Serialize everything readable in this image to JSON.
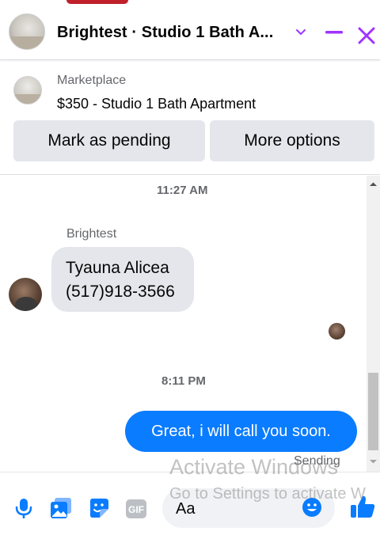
{
  "header": {
    "title": "Brightest · Studio 1 Bath A...",
    "accent_color": "#a033ff"
  },
  "listing": {
    "label": "Marketplace",
    "title": "$350 - Studio 1 Bath Apartment",
    "pending_button": "Mark as pending",
    "more_button": "More options"
  },
  "chat": {
    "timestamp_1": "11:27 AM",
    "sender_name": "Brightest",
    "incoming_line_1": "Tyauna Alicea",
    "incoming_line_2": "(517)918-3566",
    "timestamp_2": "8:11 PM",
    "outgoing_message": "Great, i will call you soon.",
    "outgoing_status": "Sending",
    "outgoing_color": "#0a7cff"
  },
  "composer": {
    "placeholder": "Aa",
    "icons": [
      "microphone-icon",
      "photo-icon",
      "sticker-icon",
      "gif-icon",
      "emoji-icon",
      "thumbs-up-icon"
    ]
  },
  "watermark": {
    "line_1": "Activate Windows",
    "line_2": "Go to Settings to activate W"
  }
}
